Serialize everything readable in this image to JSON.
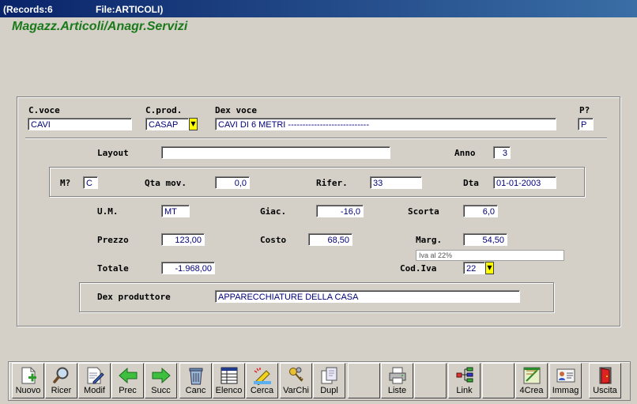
{
  "titlebar": {
    "records": "(Records:6",
    "file": "File:ARTICOLI)"
  },
  "app_title": "Magazz.Articoli/Anagr.Servizi",
  "labels": {
    "cvoce": "C.voce",
    "cprod": "C.prod.",
    "dexvoce": "Dex voce",
    "p": "P?",
    "layout": "Layout",
    "anno": "Anno",
    "m": "M?",
    "qtamov": "Qta mov.",
    "rifer": "Rifer.",
    "dta": "Dta",
    "um": "U.M.",
    "giac": "Giac.",
    "scorta": "Scorta",
    "prezzo": "Prezzo",
    "costo": "Costo",
    "marg": "Marg.",
    "totale": "Totale",
    "codiva": "Cod.Iva",
    "dexprod": "Dex produttore"
  },
  "values": {
    "cvoce": "CAVI",
    "cprod": "CASAP",
    "dexvoce": "CAVI DI 6 METRI ----------------------------",
    "p": "P",
    "layout": "",
    "anno": "3",
    "m": "C",
    "qtamov": "0,0",
    "rifer": "33",
    "dta": "01-01-2003",
    "um": "MT",
    "giac": "-16,0",
    "scorta": "6,0",
    "prezzo": "123,00",
    "costo": "68,50",
    "marg": "54,50",
    "iva_note": "Iva al 22%",
    "totale": "-1.968,00",
    "codiva": "22",
    "dexprod": "APPARECCHIATURE DELLA CASA"
  },
  "toolbar": [
    {
      "label": "Nuovo",
      "icon": "new-doc-icon"
    },
    {
      "label": "Ricer",
      "icon": "magnifier-icon"
    },
    {
      "label": "Modif",
      "icon": "edit-doc-icon"
    },
    {
      "label": "Prec",
      "icon": "arrow-left-icon"
    },
    {
      "label": "Succ",
      "icon": "arrow-right-icon"
    },
    {
      "label": "Canc",
      "icon": "trash-icon"
    },
    {
      "label": "Elenco",
      "icon": "table-icon"
    },
    {
      "label": "Cerca",
      "icon": "search-highlight-icon"
    },
    {
      "label": "VarChi",
      "icon": "keys-icon"
    },
    {
      "label": "Dupl",
      "icon": "duplicate-icon"
    },
    {
      "label": "",
      "icon": ""
    },
    {
      "label": "Liste",
      "icon": "printer-icon"
    },
    {
      "label": "",
      "icon": ""
    },
    {
      "label": "Link",
      "icon": "link-tree-icon"
    },
    {
      "label": "",
      "icon": ""
    },
    {
      "label": "4Crea",
      "icon": "create-icon"
    },
    {
      "label": "Immag",
      "icon": "id-card-icon"
    },
    {
      "label": "Uscita",
      "icon": "exit-door-icon"
    }
  ]
}
